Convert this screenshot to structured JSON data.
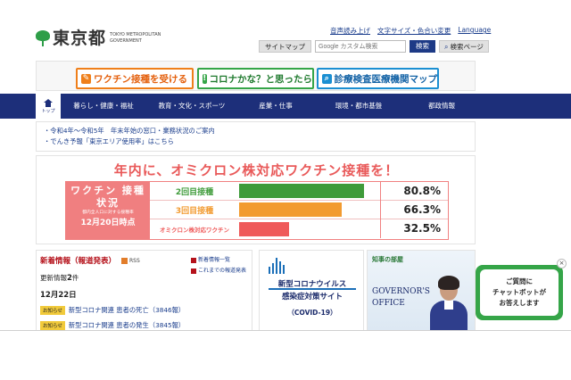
{
  "header": {
    "logo_text": "東京都",
    "logo_en": "TOKYO METROPOLITAN GOVERNMENT",
    "util_links": [
      "音声読み上げ",
      "文字サイズ・色合い変更",
      "Language"
    ],
    "sitemap_label": "サイトマップ",
    "search_placeholder": "Google カスタム検索",
    "search_button": "検索",
    "search_page_button": "検索ページ"
  },
  "banners": {
    "vaccine": "ワクチン接種を受ける",
    "corona": "コロナかな？と思ったら",
    "clinic": "診療検査医療機関マップ"
  },
  "nav": {
    "home": "トップ",
    "items": [
      "暮らし・健康・福祉",
      "教育・文化・スポーツ",
      "産業・仕事",
      "環境・都市基盤",
      "都政情報"
    ]
  },
  "notices": [
    "・令和4年〜令和5年　年末年始の窓口・業務状況のご案内",
    "・でんき予報「東京エリア使用率」はこちら"
  ],
  "vaccine_status": {
    "headline": "年内に、オミクロン株対応ワクチン接種を！",
    "panel_title": "ワクチン 接種状況",
    "panel_note": "都内全人口に対する接種率",
    "panel_date": "12月20日時点",
    "rows": [
      {
        "label": "2回目接種",
        "percent": "80.8%",
        "value": 80.8,
        "color": "#3f9b3a"
      },
      {
        "label": "3回目接種",
        "percent": "66.3%",
        "value": 66.3,
        "color": "#f29b30"
      },
      {
        "label": "オミクロン株対応ワクチン",
        "percent": "32.5%",
        "value": 32.5,
        "color": "#ef5a5a"
      }
    ]
  },
  "news": {
    "title": "新着情報（報道発表）",
    "rss": "RSS",
    "link_list": "新着情報一覧",
    "link_past": "これまでの報道発表",
    "updated_prefix": "更新情報",
    "updated_count": "2",
    "updated_suffix": "件",
    "date": "12月22日",
    "items": [
      {
        "badge": "お知らせ",
        "text": "新型コロナ関連 患者の死亡（3846報）"
      },
      {
        "badge": "お知らせ",
        "text": "新型コロナ関連 患者の発生（3845報）"
      }
    ]
  },
  "covid_site": {
    "line1": "新型コロナウイルス",
    "line2": "感染症対策サイト",
    "line3": "（COVID-19）"
  },
  "governor": {
    "room": "知事の部屋",
    "en_line1": "GOVERNOR'S",
    "en_line2": "OFFICE"
  },
  "chatbot": {
    "line1": "ご質問に",
    "line2": "チャットボットが",
    "line3": "お答えします",
    "close": "×"
  }
}
